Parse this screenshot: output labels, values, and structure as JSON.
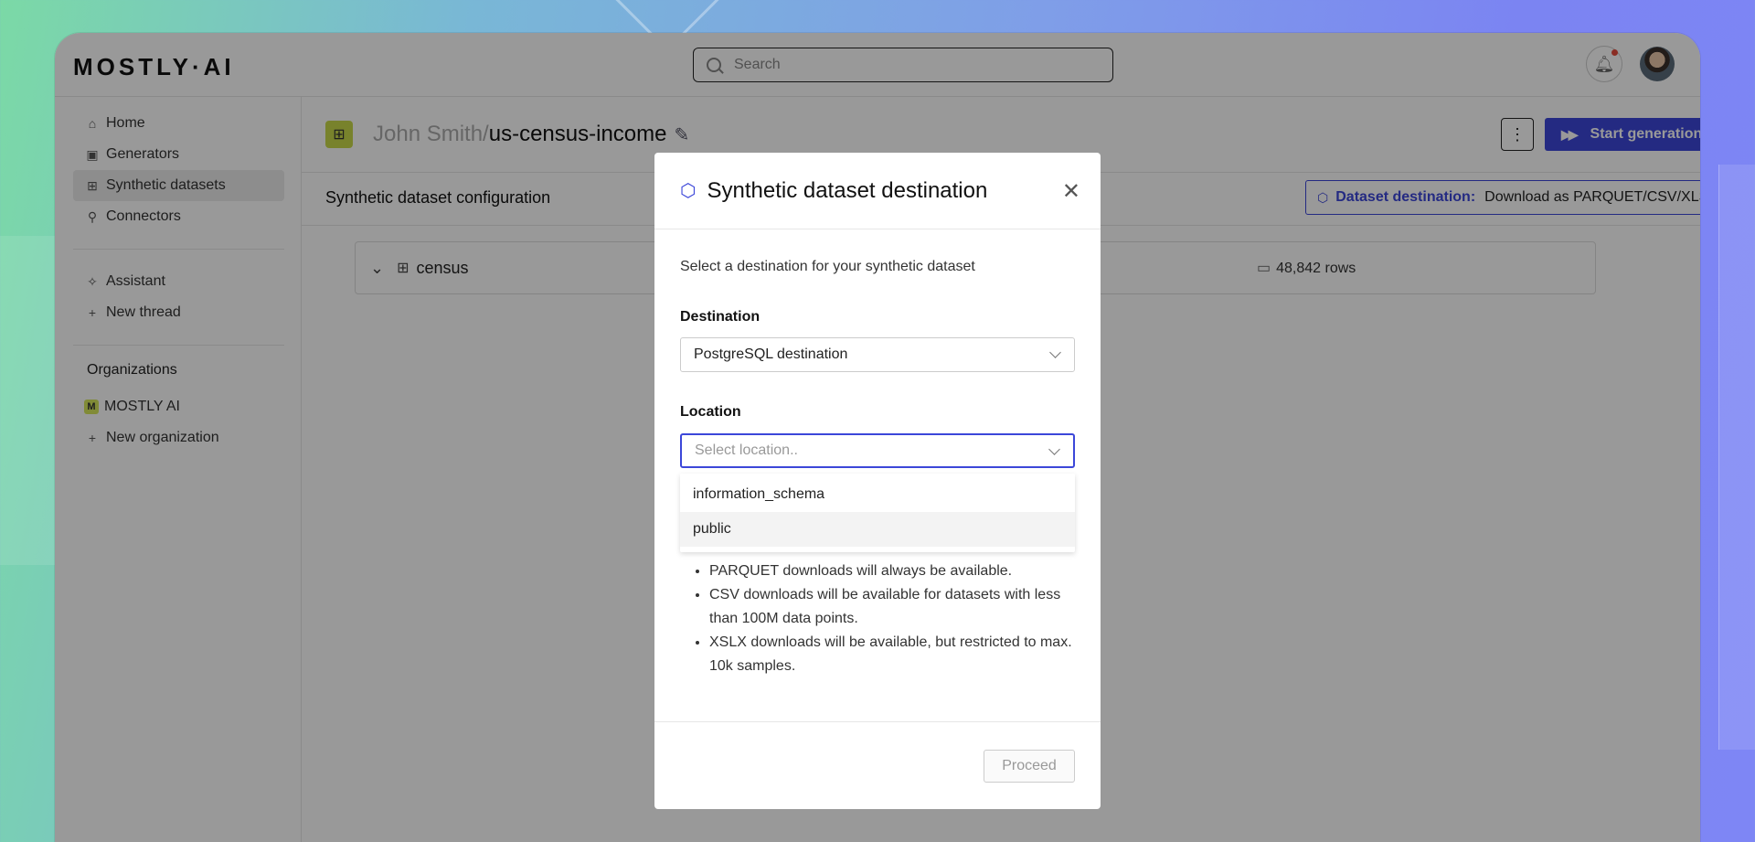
{
  "app": {
    "logo": "MOSTLY·AI"
  },
  "topbar": {
    "search_placeholder": "Search"
  },
  "sidebar": {
    "items": [
      {
        "label": "Home",
        "icon": "home-icon"
      },
      {
        "label": "Generators",
        "icon": "generator-icon"
      },
      {
        "label": "Synthetic datasets",
        "icon": "dataset-icon"
      },
      {
        "label": "Connectors",
        "icon": "plug-icon"
      }
    ],
    "assistant": [
      {
        "label": "Assistant",
        "icon": "sparkle-icon"
      },
      {
        "label": "New thread",
        "icon": "plus-icon"
      }
    ],
    "organizations_title": "Organizations",
    "organizations": [
      {
        "label": "MOSTLY AI",
        "badge": "M"
      },
      {
        "label": "New organization",
        "icon": "plus-icon"
      }
    ]
  },
  "header": {
    "owner": "John Smith/",
    "dataset": "us-census-income",
    "start_label": "Start generation"
  },
  "config": {
    "title": "Synthetic dataset configuration",
    "destination_label": "Dataset destination:",
    "destination_value": "Download as PARQUET/CSV/XLSX",
    "table_name": "census",
    "rows": "48,842 rows"
  },
  "modal": {
    "title": "Synthetic dataset destination",
    "subtitle": "Select a destination for your synthetic dataset",
    "destination_label": "Destination",
    "destination_value": "PostgreSQL destination",
    "location_label": "Location",
    "location_placeholder": "Select location..",
    "location_options": [
      "information_schema",
      "public"
    ],
    "info": [
      "PARQUET downloads will always be available.",
      "CSV downloads will be available for datasets with less than 100M data points.",
      "XSLX downloads will be available, but restricted to max. 10k samples."
    ],
    "proceed_label": "Proceed"
  }
}
